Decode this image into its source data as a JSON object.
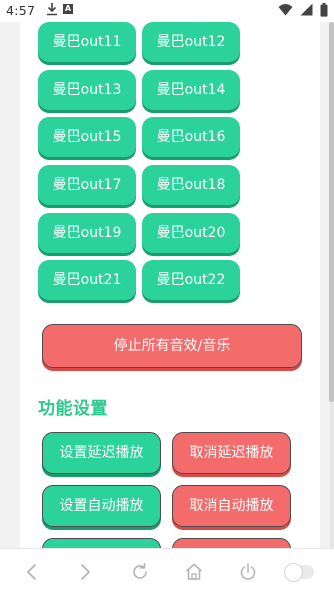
{
  "status_bar": {
    "time": "4:57",
    "a_badge": "A"
  },
  "out_buttons": [
    "曼巴out11",
    "曼巴out12",
    "曼巴out13",
    "曼巴out14",
    "曼巴out15",
    "曼巴out16",
    "曼巴out17",
    "曼巴out18",
    "曼巴out19",
    "曼巴out20",
    "曼巴out21",
    "曼巴out22"
  ],
  "stop_all_label": "停止所有音效/音乐",
  "function_settings": {
    "title": "功能设置",
    "set_delay_label": "设置延迟播放",
    "cancel_delay_label": "取消延迟播放",
    "set_auto_label": "设置自动播放",
    "cancel_auto_label": "取消自动播放"
  },
  "bottom_nav": {
    "icons": [
      "back-icon",
      "forward-icon",
      "refresh-icon",
      "home-icon",
      "power-icon",
      "toggle-switch"
    ],
    "toggle_on": false
  },
  "colors": {
    "green": "#2bd39a",
    "red": "#f46b6b",
    "section_title": "#2bc98d"
  }
}
